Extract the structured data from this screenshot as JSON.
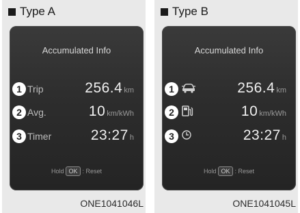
{
  "panels": [
    {
      "type_label": "Type A",
      "screen_title": "Accumulated Info",
      "rows": [
        {
          "num": "1",
          "label": "Trip",
          "value": "256.4",
          "unit": "km"
        },
        {
          "num": "2",
          "label": "Avg.",
          "value": "10",
          "unit": "km/kWh"
        },
        {
          "num": "3",
          "label": "Timer",
          "value": "23:27",
          "unit": "h"
        }
      ],
      "hold_text": "Hold",
      "ok_text": "OK",
      "reset_text": ": Reset",
      "code": "ONE1041046L"
    },
    {
      "type_label": "Type B",
      "screen_title": "Accumulated Info",
      "rows": [
        {
          "num": "1",
          "icon": "car-icon",
          "value": "256.4",
          "unit": "km"
        },
        {
          "num": "2",
          "icon": "charging-station-icon",
          "value": "10",
          "unit": "km/kWh"
        },
        {
          "num": "3",
          "icon": "clock-icon",
          "value": "23:27",
          "unit": "h"
        }
      ],
      "hold_text": "Hold",
      "ok_text": "OK",
      "reset_text": ": Reset",
      "code": "ONE1041045L"
    }
  ]
}
